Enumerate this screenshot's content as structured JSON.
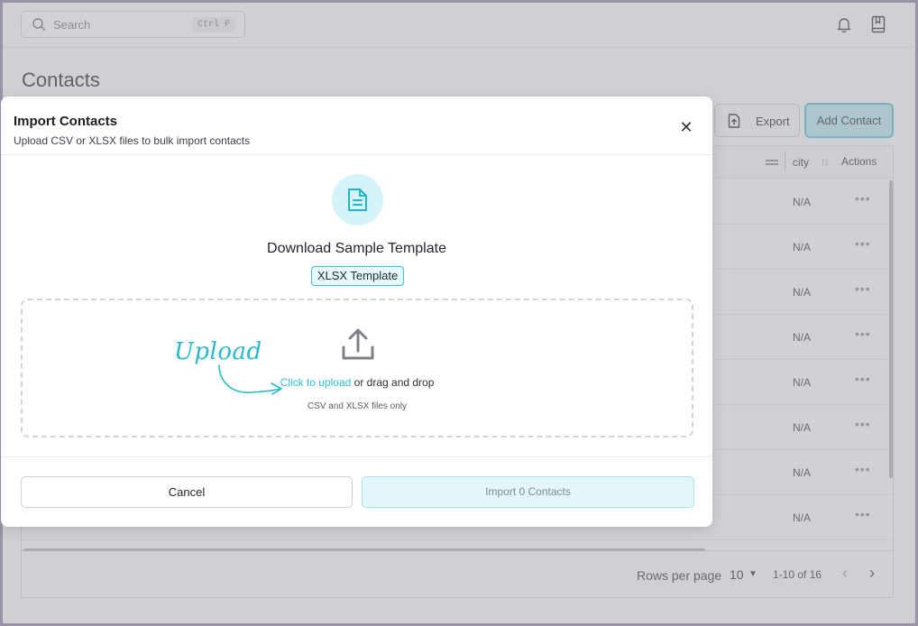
{
  "header": {
    "search_placeholder": "Search",
    "search_shortcut": "Ctrl F",
    "notification_icon": "bell-icon",
    "docs_icon": "book-icon"
  },
  "page": {
    "title": "Contacts",
    "export_label": "Export",
    "add_contact_label": "Add Contact",
    "accent_color": "#5fbfcf"
  },
  "table": {
    "columns": [
      "city",
      "Actions"
    ],
    "rows": [
      {
        "city": "N/A",
        "actions": "•••"
      },
      {
        "city": "N/A",
        "actions": "•••"
      },
      {
        "city": "N/A",
        "actions": "•••"
      },
      {
        "city": "N/A",
        "actions": "•••"
      },
      {
        "city": "N/A",
        "actions": "•••"
      },
      {
        "city": "N/A",
        "actions": "•••"
      },
      {
        "city": "N/A",
        "actions": "•••"
      },
      {
        "city": "N/A",
        "actions": "•••"
      }
    ]
  },
  "pagination": {
    "rows_per_page_label": "Rows per page",
    "rows_per_page_value": "10",
    "range": "1-10 of 16"
  },
  "modal": {
    "title": "Import Contacts",
    "subtitle": "Upload CSV or XLSX files to bulk import contacts",
    "template_heading": "Download Sample Template",
    "template_button": "XLSX Template",
    "upload_annotation": "Upload",
    "click_to_upload": "Click to upload",
    "drag_drop_text": " or drag and drop",
    "file_types_hint": "CSV and XLSX files only",
    "cancel_label": "Cancel",
    "import_label": "Import 0 Contacts",
    "accent_color": "#2dbfd3"
  }
}
